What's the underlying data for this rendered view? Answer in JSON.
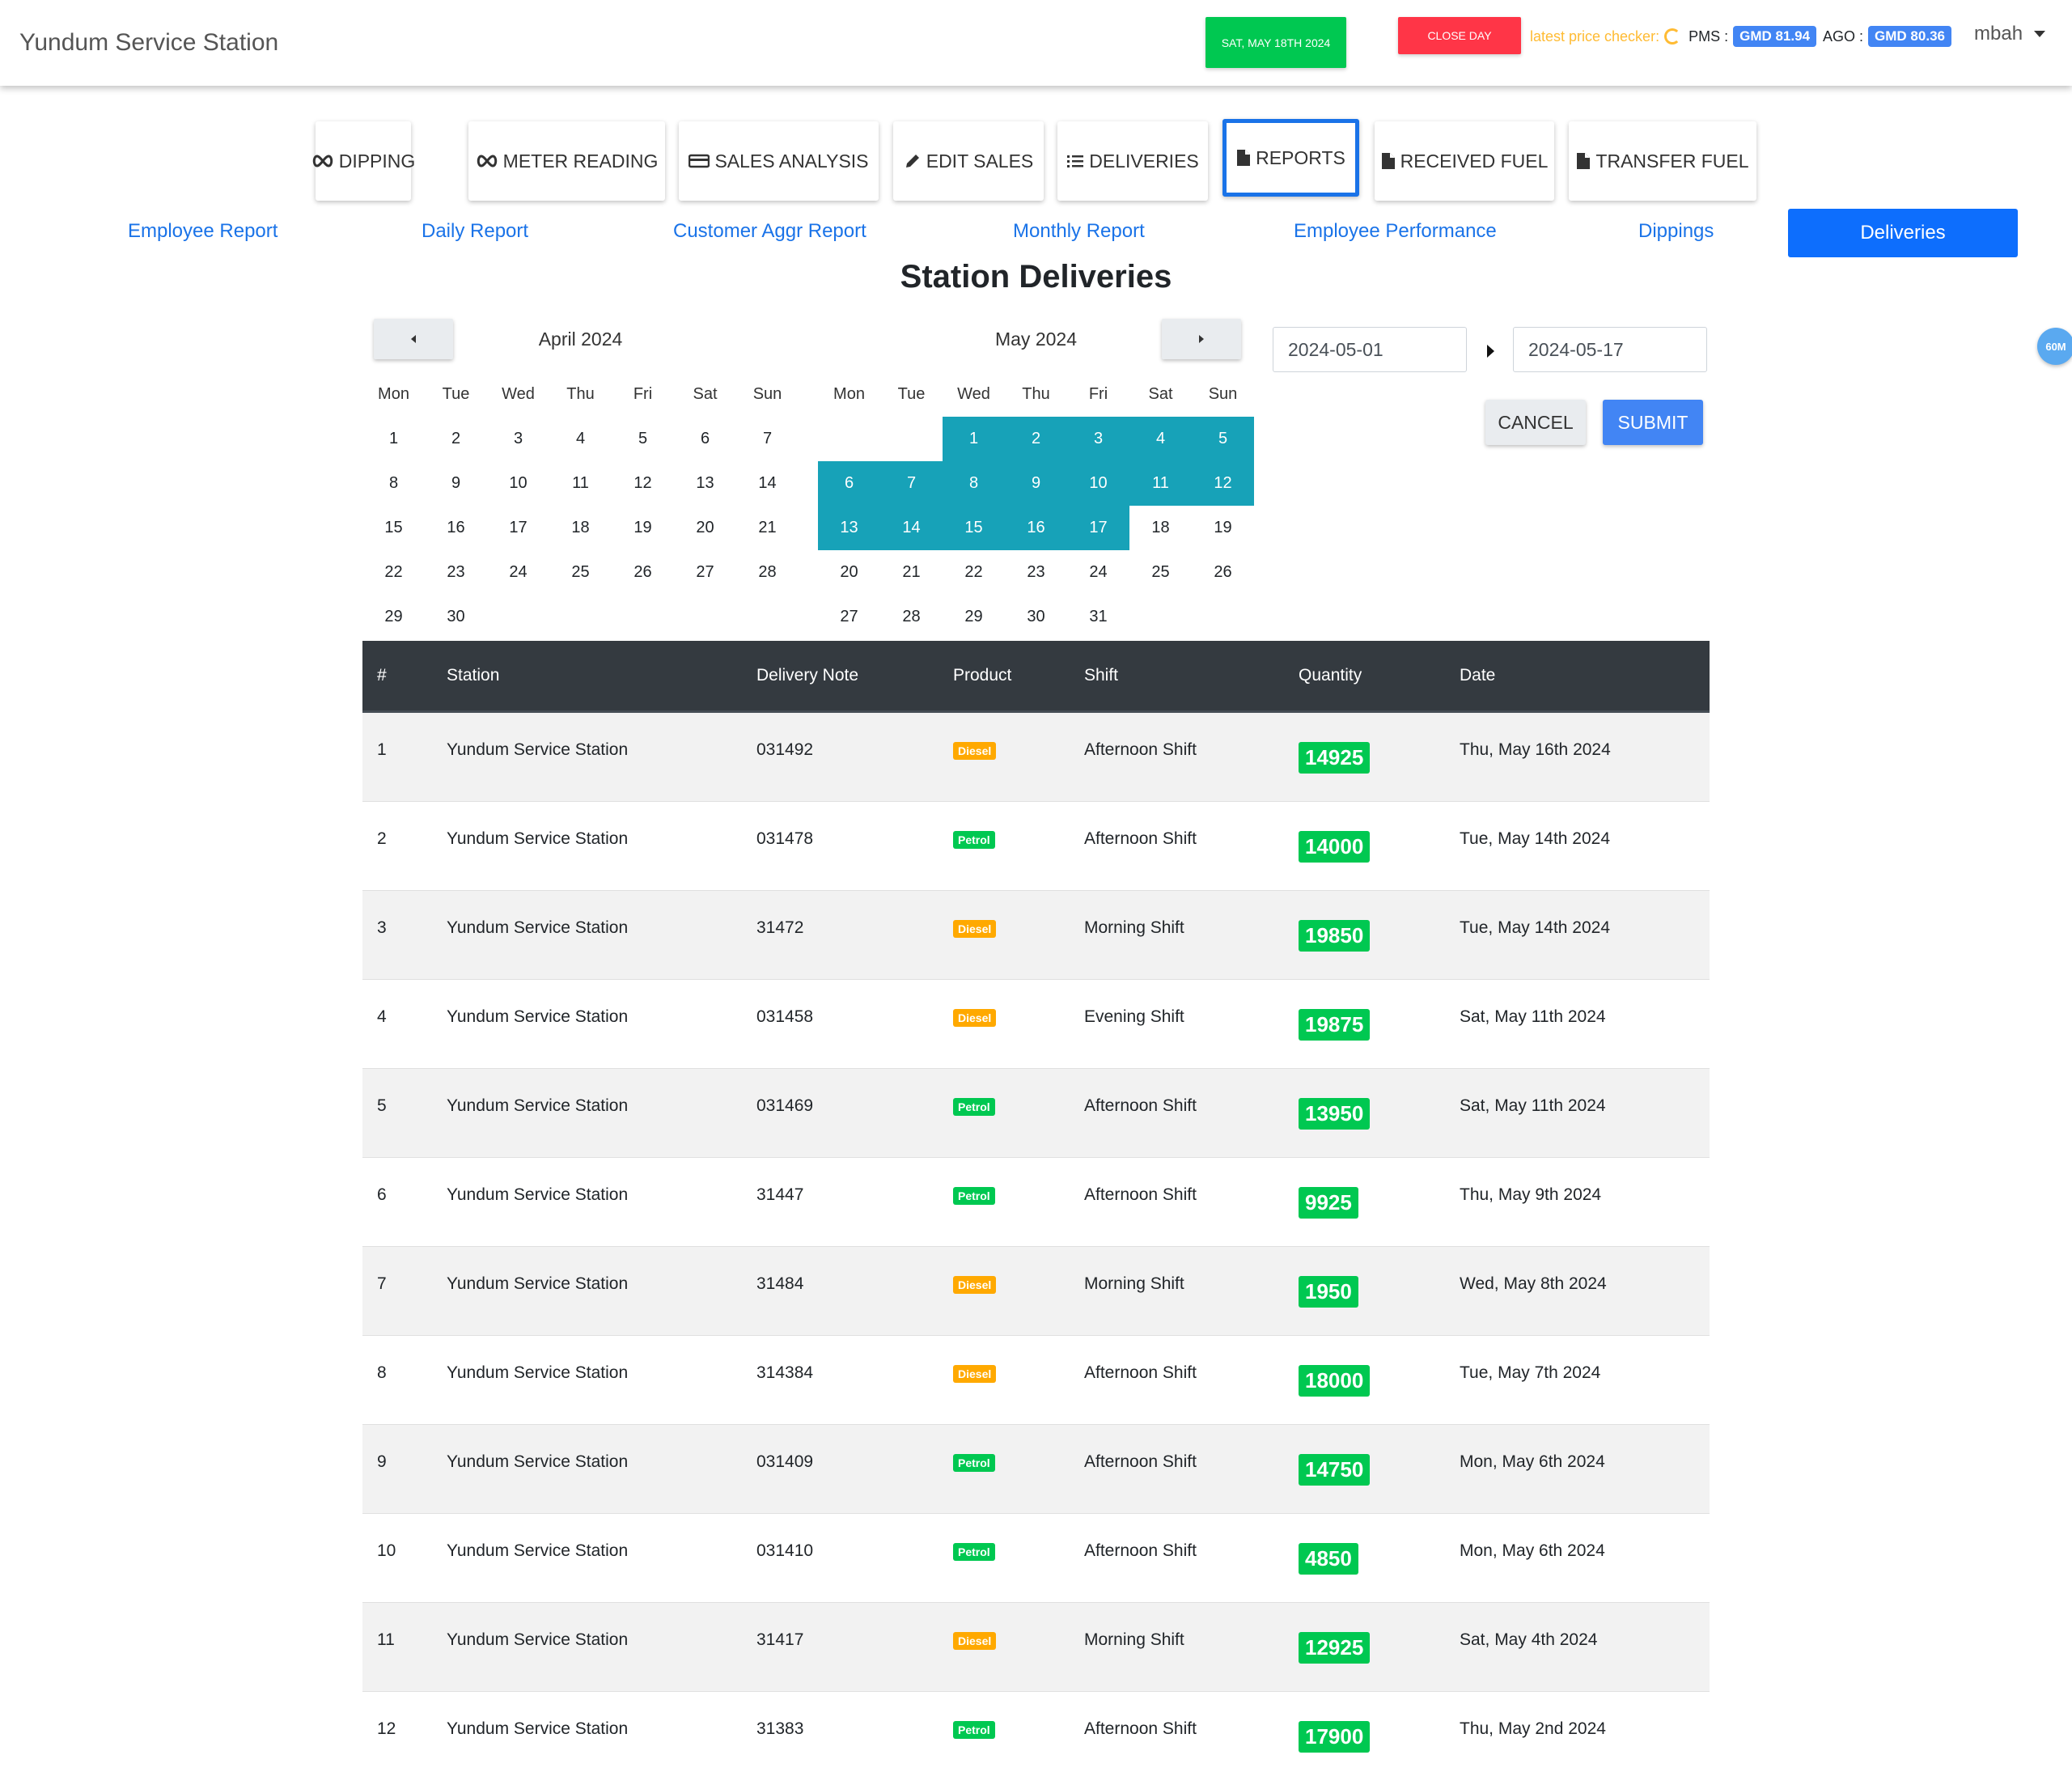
{
  "header": {
    "brand": "Yundum Service Station",
    "date_button": "SAT, MAY 18TH 2024",
    "close_button": "CLOSE DAY",
    "price_label": "latest price checker:",
    "pms_label": "PMS :",
    "pms_price": "GMD 81.94",
    "ago_label": "AGO :",
    "ago_price": "GMD 80.36",
    "user": "mbah"
  },
  "nav": [
    {
      "label": "DIPPING",
      "icon": "infinity-icon"
    },
    {
      "label": "METER READING",
      "icon": "infinity-icon"
    },
    {
      "label": "SALES ANALYSIS",
      "icon": "card-icon"
    },
    {
      "label": "EDIT SALES",
      "icon": "pencil-icon"
    },
    {
      "label": "DELIVERIES",
      "icon": "list-icon"
    },
    {
      "label": "REPORTS",
      "icon": "file-icon",
      "active": true
    },
    {
      "label": "RECEIVED FUEL",
      "icon": "file-icon"
    },
    {
      "label": "TRANSFER FUEL",
      "icon": "file-icon"
    }
  ],
  "subnav": {
    "employee_report": "Employee Report",
    "daily_report": "Daily Report",
    "customer_aggr_report": "Customer Aggr Report",
    "monthly_report": "Monthly Report",
    "employee_performance": "Employee Performance",
    "dippings": "Dippings",
    "deliveries": "Deliveries"
  },
  "page_title": "Station Deliveries",
  "calendar": {
    "weekdays": [
      "Mon",
      "Tue",
      "Wed",
      "Thu",
      "Fri",
      "Sat",
      "Sun"
    ],
    "left_month": "April 2024",
    "right_month": "May 2024",
    "april_first_weekday_index": 0,
    "april_days": 30,
    "may_first_weekday_index": 2,
    "may_days": 31,
    "selected_range": [
      "2024-05-01",
      "2024-05-17"
    ]
  },
  "range": {
    "start": "2024-05-01",
    "end": "2024-05-17",
    "cancel": "CANCEL",
    "submit": "SUBMIT"
  },
  "float_badge": "60M",
  "colors": {
    "diesel": "#ffa900",
    "petrol": "#00c851",
    "quantity": "#00c851",
    "calendar_selected": "#17a2b8",
    "primary": "#0d6efd"
  },
  "table": {
    "headers": [
      "#",
      "Station",
      "Delivery Note",
      "Product",
      "Shift",
      "Quantity",
      "Date"
    ],
    "rows": [
      {
        "no": "1",
        "station": "Yundum Service Station",
        "note": "031492",
        "product": "Diesel",
        "shift": "Afternoon Shift",
        "qty": "14925",
        "date": "Thu, May 16th 2024"
      },
      {
        "no": "2",
        "station": "Yundum Service Station",
        "note": "031478",
        "product": "Petrol",
        "shift": "Afternoon Shift",
        "qty": "14000",
        "date": "Tue, May 14th 2024"
      },
      {
        "no": "3",
        "station": "Yundum Service Station",
        "note": "31472",
        "product": "Diesel",
        "shift": "Morning Shift",
        "qty": "19850",
        "date": "Tue, May 14th 2024"
      },
      {
        "no": "4",
        "station": "Yundum Service Station",
        "note": "031458",
        "product": "Diesel",
        "shift": "Evening Shift",
        "qty": "19875",
        "date": "Sat, May 11th 2024"
      },
      {
        "no": "5",
        "station": "Yundum Service Station",
        "note": "031469",
        "product": "Petrol",
        "shift": "Afternoon Shift",
        "qty": "13950",
        "date": "Sat, May 11th 2024"
      },
      {
        "no": "6",
        "station": "Yundum Service Station",
        "note": "31447",
        "product": "Petrol",
        "shift": "Afternoon Shift",
        "qty": "9925",
        "date": "Thu, May 9th 2024"
      },
      {
        "no": "7",
        "station": "Yundum Service Station",
        "note": "31484",
        "product": "Diesel",
        "shift": "Morning Shift",
        "qty": "1950",
        "date": "Wed, May 8th 2024"
      },
      {
        "no": "8",
        "station": "Yundum Service Station",
        "note": "314384",
        "product": "Diesel",
        "shift": "Afternoon Shift",
        "qty": "18000",
        "date": "Tue, May 7th 2024"
      },
      {
        "no": "9",
        "station": "Yundum Service Station",
        "note": "031409",
        "product": "Petrol",
        "shift": "Afternoon Shift",
        "qty": "14750",
        "date": "Mon, May 6th 2024"
      },
      {
        "no": "10",
        "station": "Yundum Service Station",
        "note": "031410",
        "product": "Petrol",
        "shift": "Afternoon Shift",
        "qty": "4850",
        "date": "Mon, May 6th 2024"
      },
      {
        "no": "11",
        "station": "Yundum Service Station",
        "note": "31417",
        "product": "Diesel",
        "shift": "Morning Shift",
        "qty": "12925",
        "date": "Sat, May 4th 2024"
      },
      {
        "no": "12",
        "station": "Yundum Service Station",
        "note": "31383",
        "product": "Petrol",
        "shift": "Afternoon Shift",
        "qty": "17900",
        "date": "Thu, May 2nd 2024"
      }
    ]
  }
}
